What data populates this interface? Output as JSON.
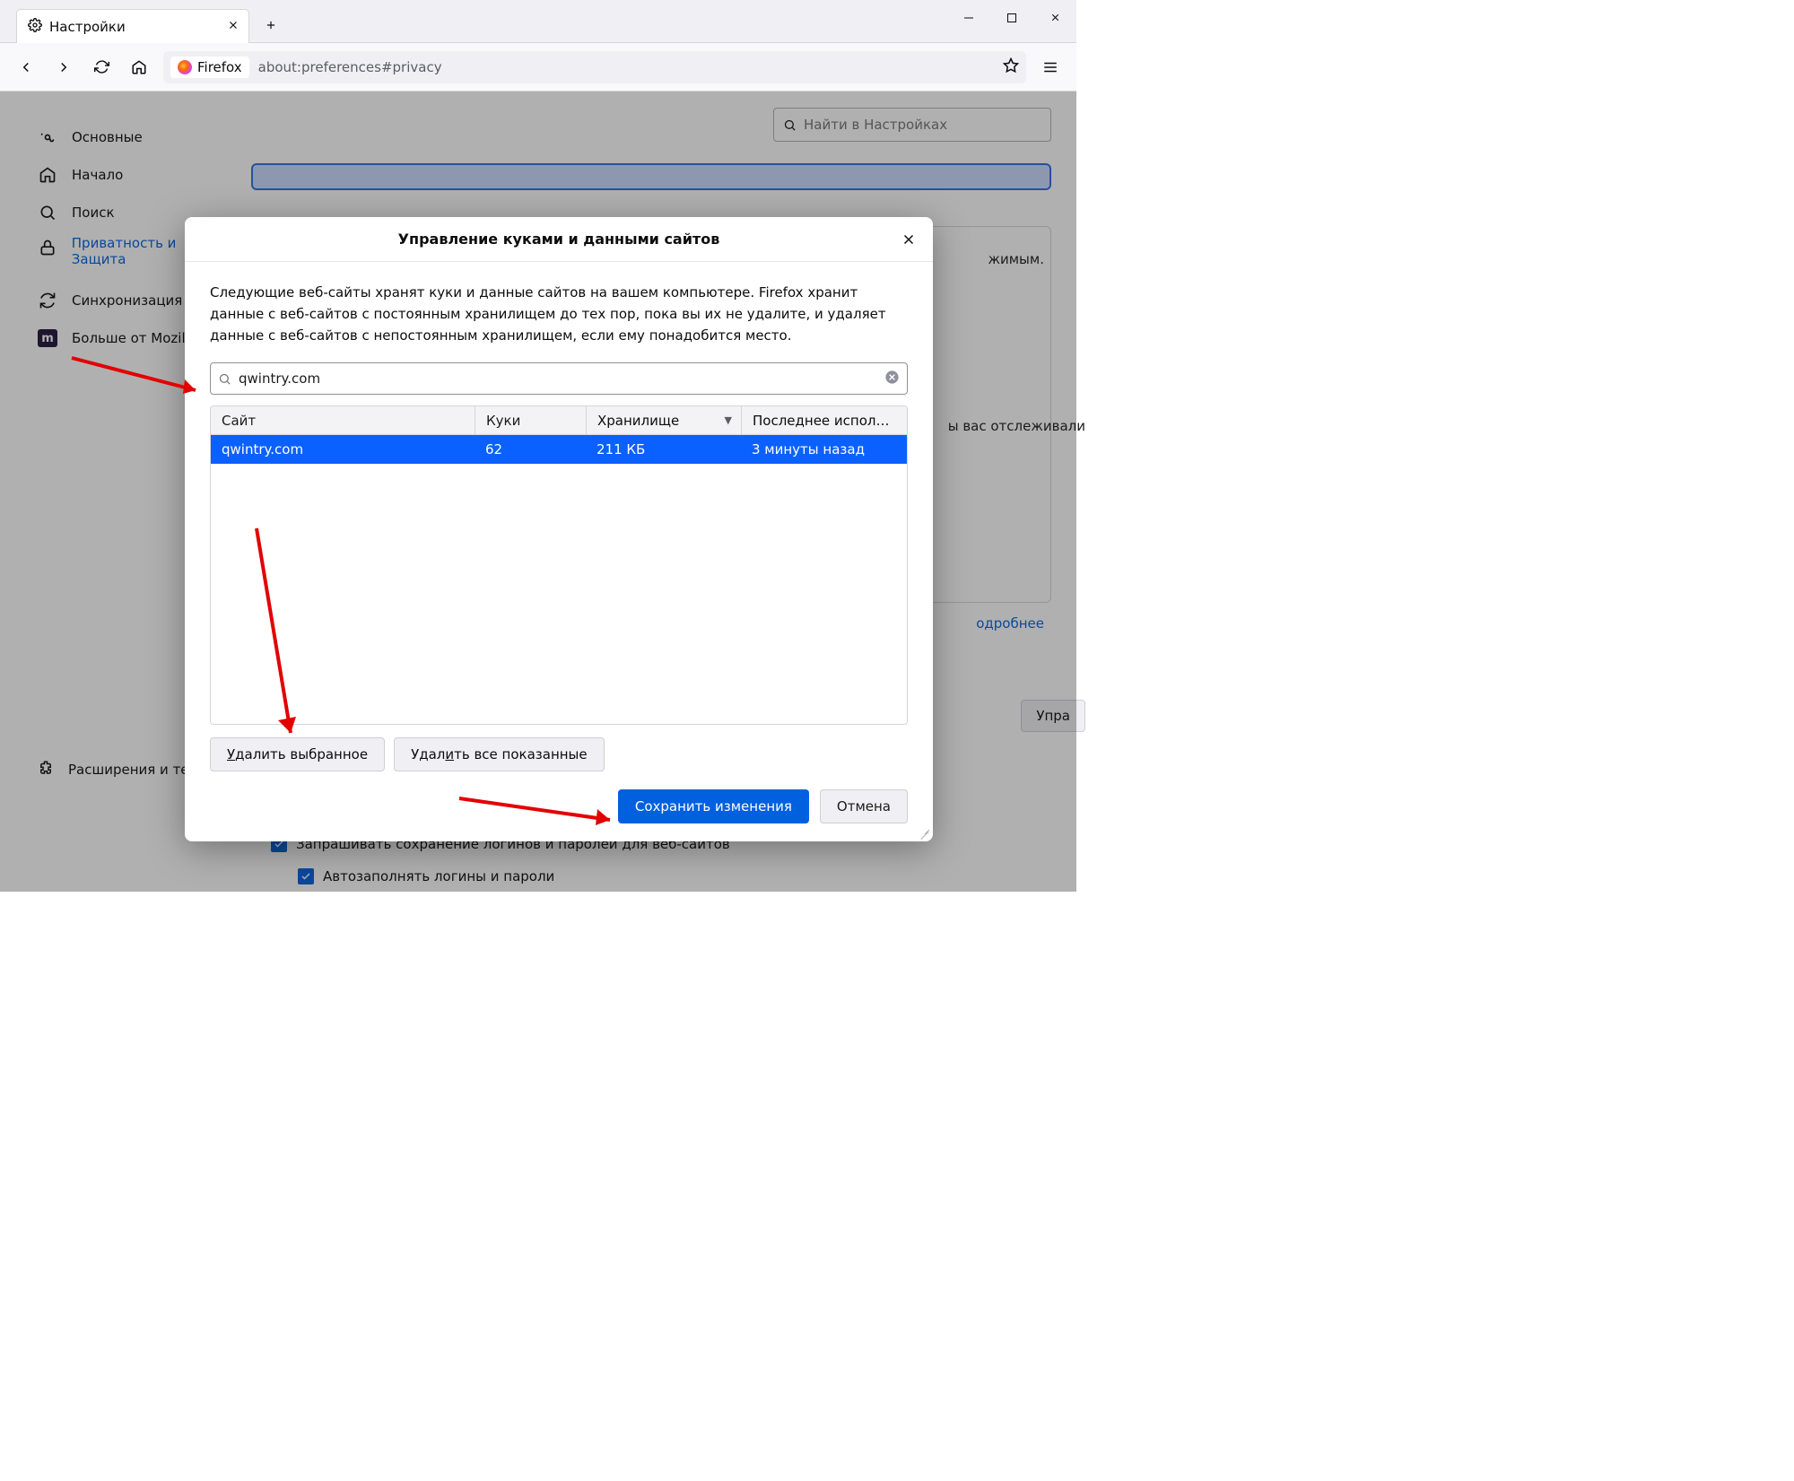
{
  "tab": {
    "title": "Настройки"
  },
  "toolbar": {
    "firefox_badge": "Firefox",
    "url": "about:preferences#privacy"
  },
  "prefs_search_placeholder": "Найти в Настройках",
  "sidebar": {
    "general": "Основные",
    "home": "Начало",
    "search": "Поиск",
    "privacy": "Приватность и Защита",
    "sync": "Синхронизация",
    "mozilla": "Больше от Mozilla",
    "addons": "Расширения и темы"
  },
  "bg": {
    "text1_suffix": "жимым.",
    "text2_suffix": "ы вас отслеживали",
    "link_more": "одробнее",
    "manage_btn": "Упра",
    "cb1": "Запрашивать сохранение логинов и паролей для веб-сайтов",
    "cb2": "Автозаполнять логины и пароли"
  },
  "dialog": {
    "title": "Управление куками и данными сайтов",
    "desc": "Следующие веб-сайты хранят куки и данные сайтов на вашем компьютере. Firefox хранит данные с веб-сайтов с постоянным хранилищем до тех пор, пока вы их не удалите, и удаляет данные с веб-сайтов с непостоянным хранилищем, если ему понадобится место.",
    "search_value": "qwintry.com",
    "columns": {
      "site": "Сайт",
      "cookies": "Куки",
      "storage": "Хранилище",
      "last": "Последнее использование"
    },
    "row": {
      "site": "qwintry.com",
      "cookies": "62",
      "storage": "211 КБ",
      "last": "3 минуты назад"
    },
    "delete_selected": {
      "pre": "",
      "u": "У",
      "post": "далить выбранное"
    },
    "delete_all": {
      "pre": "Удал",
      "u": "и",
      "post": "ть все показанные"
    },
    "save": "Сохранить изменения",
    "cancel": "Отмена"
  }
}
